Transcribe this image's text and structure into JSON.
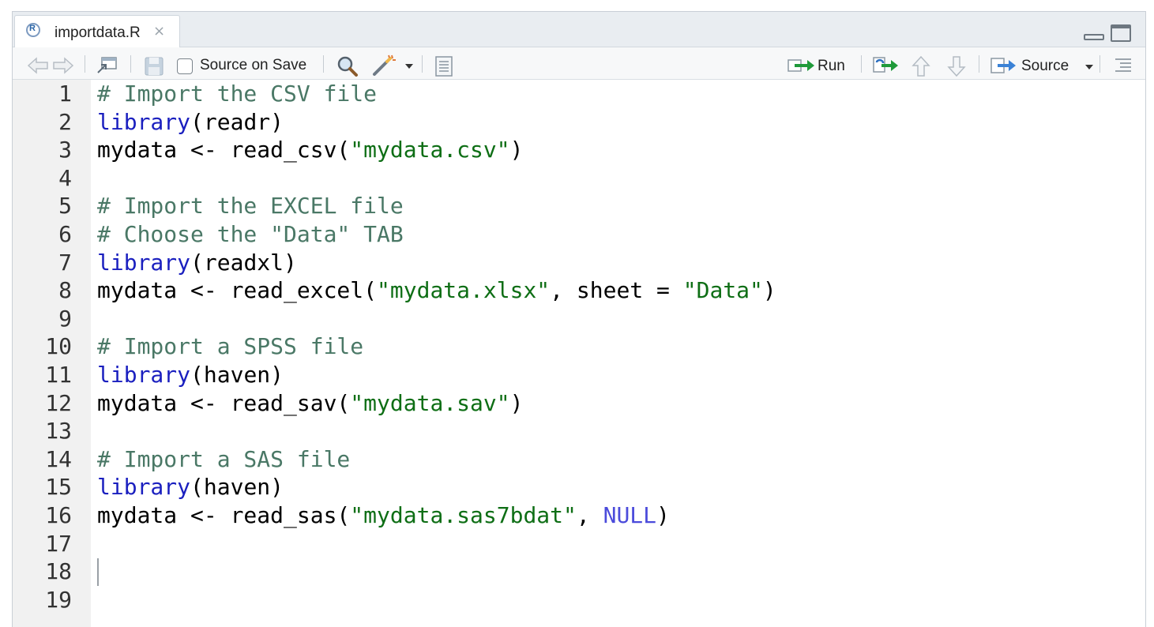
{
  "tab": {
    "title": "importdata.R",
    "close": "×",
    "logo": "R"
  },
  "toolbar": {
    "source_on_save": "Source on Save",
    "run": "Run",
    "source": "Source"
  },
  "editor": {
    "line_numbers": [
      "1",
      "2",
      "3",
      "4",
      "5",
      "6",
      "7",
      "8",
      "9",
      "10",
      "11",
      "12",
      "13",
      "14",
      "15",
      "16",
      "17",
      "18",
      "19"
    ],
    "lines": [
      {
        "tokens": [
          {
            "t": "# Import the CSV file",
            "c": "cmt"
          }
        ]
      },
      {
        "tokens": [
          {
            "t": "library",
            "c": "kw"
          },
          {
            "t": "(readr)",
            "c": "plain"
          }
        ]
      },
      {
        "tokens": [
          {
            "t": "mydata <- read_csv(",
            "c": "plain"
          },
          {
            "t": "\"mydata.csv\"",
            "c": "str"
          },
          {
            "t": ")",
            "c": "plain"
          }
        ]
      },
      {
        "tokens": []
      },
      {
        "tokens": [
          {
            "t": "# Import the EXCEL file",
            "c": "cmt"
          }
        ]
      },
      {
        "tokens": [
          {
            "t": "# Choose the \"Data\" TAB",
            "c": "cmt"
          }
        ]
      },
      {
        "tokens": [
          {
            "t": "library",
            "c": "kw"
          },
          {
            "t": "(readxl)",
            "c": "plain"
          }
        ]
      },
      {
        "tokens": [
          {
            "t": "mydata <- read_excel(",
            "c": "plain"
          },
          {
            "t": "\"mydata.xlsx\"",
            "c": "str"
          },
          {
            "t": ", sheet = ",
            "c": "plain"
          },
          {
            "t": "\"Data\"",
            "c": "str"
          },
          {
            "t": ")",
            "c": "plain"
          }
        ]
      },
      {
        "tokens": []
      },
      {
        "tokens": [
          {
            "t": "# Import a SPSS file",
            "c": "cmt"
          }
        ]
      },
      {
        "tokens": [
          {
            "t": "library",
            "c": "kw"
          },
          {
            "t": "(haven)",
            "c": "plain"
          }
        ]
      },
      {
        "tokens": [
          {
            "t": "mydata <- read_sav(",
            "c": "plain"
          },
          {
            "t": "\"mydata.sav\"",
            "c": "str"
          },
          {
            "t": ")",
            "c": "plain"
          }
        ]
      },
      {
        "tokens": []
      },
      {
        "tokens": [
          {
            "t": "# Import a SAS file",
            "c": "cmt"
          }
        ]
      },
      {
        "tokens": [
          {
            "t": "library",
            "c": "kw"
          },
          {
            "t": "(haven)",
            "c": "plain"
          }
        ]
      },
      {
        "tokens": [
          {
            "t": "mydata <- read_sas(",
            "c": "plain"
          },
          {
            "t": "\"mydata.sas7bdat\"",
            "c": "str"
          },
          {
            "t": ", ",
            "c": "plain"
          },
          {
            "t": "NULL",
            "c": "nul"
          },
          {
            "t": ")",
            "c": "plain"
          }
        ]
      },
      {
        "tokens": []
      },
      {
        "tokens": []
      },
      {
        "tokens": []
      }
    ]
  },
  "colors": {
    "comment": "#4a7866",
    "keyword": "#1a1fbf",
    "string": "#0e6e15",
    "null": "#4b4bdb"
  },
  "icons": [
    "r-file-icon",
    "close-icon",
    "back-arrow-icon",
    "forward-arrow-icon",
    "show-in-window-icon",
    "save-icon",
    "search-icon",
    "magic-wand-icon",
    "dropdown-arrow-icon",
    "compile-report-icon",
    "run-icon",
    "rerun-icon",
    "up-arrow-icon",
    "down-arrow-icon",
    "source-icon",
    "outline-icon",
    "minimize-icon",
    "maximize-icon"
  ]
}
